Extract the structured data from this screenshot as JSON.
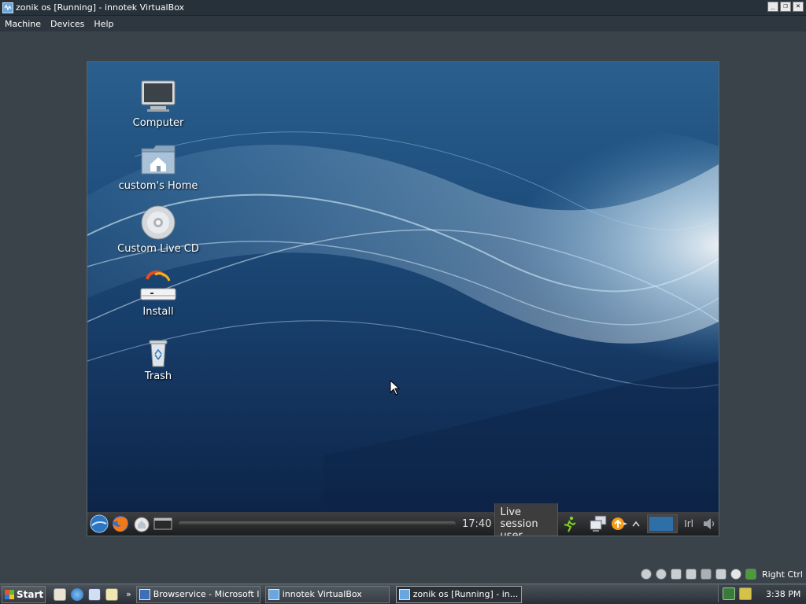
{
  "window": {
    "title": "zonik os [Running] - innotek VirtualBox",
    "controls": {
      "minimize": "_",
      "restore": "❐",
      "close": "✕"
    }
  },
  "menu": {
    "items": [
      "Machine",
      "Devices",
      "Help"
    ]
  },
  "desktop": {
    "icons": [
      {
        "label": "Computer",
        "icon": "computer-icon"
      },
      {
        "label": "custom's Home",
        "icon": "home-folder-icon"
      },
      {
        "label": "Custom Live CD",
        "icon": "cd-icon"
      },
      {
        "label": "Install",
        "icon": "install-icon"
      },
      {
        "label": "Trash",
        "icon": "trash-icon"
      }
    ]
  },
  "guest_panel": {
    "clock": "17:40",
    "session_user": "Live session user",
    "keyboard_layout": "Irl",
    "launchers": [
      "menu-icon",
      "firefox-icon",
      "network-places-icon",
      "terminal-icon"
    ],
    "tray": [
      "logout-icon",
      "network-icon",
      "update-icon",
      "arrow-icon",
      "workspace-pager",
      "volume-icon"
    ]
  },
  "vbox_status": {
    "host_key": "Right Ctrl"
  },
  "taskbar": {
    "start_label": "Start",
    "quicklaunch_more": "»",
    "tasks": [
      {
        "label": "Browservice - Microsoft I...",
        "active": false
      },
      {
        "label": "innotek VirtualBox",
        "active": false
      },
      {
        "label": "zonik os [Running] - in...",
        "active": true
      }
    ],
    "clock": "3:38 PM"
  }
}
